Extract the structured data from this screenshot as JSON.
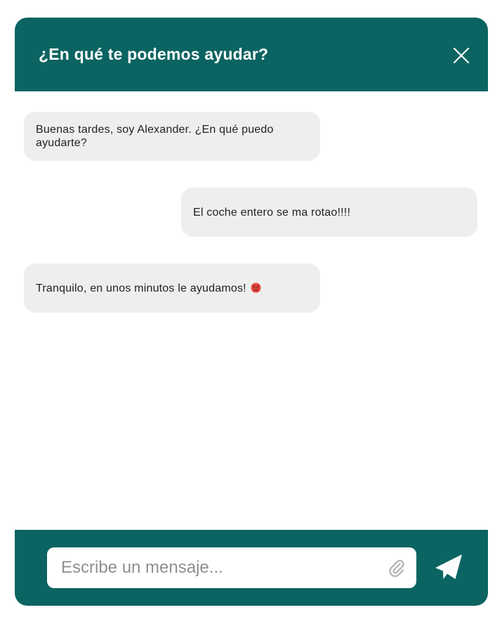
{
  "header": {
    "title": "¿En qué te podemos ayudar?",
    "close_icon": "close-icon"
  },
  "messages": [
    {
      "from": "agent",
      "text": "Buenas tardes, soy Alexander. ¿En qué puedo ayudarte?"
    },
    {
      "from": "user",
      "text": "El coche entero se ma rotao!!!!"
    },
    {
      "from": "agent",
      "text": "Tranquilo, en unos minutos le ayudamos!",
      "emoji": "angry-face-emoji"
    }
  ],
  "composer": {
    "placeholder": "Escribe un mensaje...",
    "value": "",
    "attach_icon": "paperclip-icon",
    "send_icon": "paper-plane-icon"
  },
  "colors": {
    "brand": "#0b6461",
    "bubble": "#eeeeee",
    "header_text": "#ffffff"
  }
}
